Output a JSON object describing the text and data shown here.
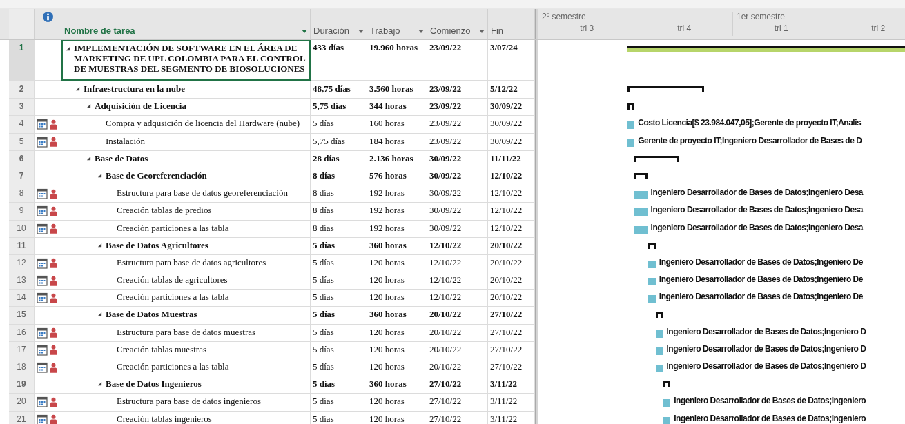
{
  "columns": [
    {
      "label": "Nombre de tarea",
      "kind": "name",
      "selected": true
    },
    {
      "label": "Duración",
      "kind": "filter",
      "selected": false
    },
    {
      "label": "Trabajo",
      "kind": "filter",
      "selected": false
    },
    {
      "label": "Comienzo",
      "kind": "filter",
      "selected": false
    },
    {
      "label": "Fin",
      "kind": "plain",
      "selected": false
    }
  ],
  "timescale": {
    "semesters": [
      "2º semestre",
      "1er semestre"
    ],
    "quarters": [
      "tri 3",
      "tri 4",
      "tri 1",
      "tri 2"
    ]
  },
  "tasks": [
    {
      "id": "1",
      "kind": "project",
      "selected": true,
      "expanded": true,
      "name": "IMPLEMENTACIÓN DE SOFTWARE EN EL ÁREA DE MARKETING DE UPL COLOMBIA PARA EL CONTROL DE MUESTRAS DEL SEGMENTO DE BIOSOLUCIONES",
      "duration": "433 días",
      "work": "19.960 horas",
      "start": "23/09/22",
      "finish": "3/07/24",
      "children": [
        {
          "id": "2",
          "kind": "summary",
          "selected": false,
          "expanded": true,
          "name": "Infraestructura en la nube",
          "duration": "48,75 días",
          "work": "3.560 horas",
          "start": "23/09/22",
          "finish": "5/12/22",
          "children": [
            {
              "id": "3",
              "kind": "summary",
              "selected": false,
              "expanded": true,
              "name": "Adquisición de Licencia",
              "duration": "5,75 días",
              "work": "344 horas",
              "start": "23/09/22",
              "finish": "30/09/22",
              "children": [
                {
                  "id": "4",
                  "kind": "task",
                  "selected": false,
                  "name": "Compra y adqusición de licencia del Hardware (nube)",
                  "duration": "5 días",
                  "work": "160 horas",
                  "start": "23/09/22",
                  "finish": "30/09/22",
                  "resources": "Costo Licencia[$ 23.984.047,05];Gerente de proyecto IT;Analis"
                },
                {
                  "id": "5",
                  "kind": "task",
                  "selected": false,
                  "name": "Instalación",
                  "duration": "5,75 días",
                  "work": "184 horas",
                  "start": "23/09/22",
                  "finish": "30/09/22",
                  "resources": "Gerente de proyecto IT;Ingeniero Desarrollador de Bases de D"
                }
              ]
            },
            {
              "id": "6",
              "kind": "summary",
              "selected": false,
              "expanded": true,
              "name": "Base de Datos",
              "duration": "28 días",
              "work": "2.136 horas",
              "start": "30/09/22",
              "finish": "11/11/22",
              "children": [
                {
                  "id": "7",
                  "kind": "summary",
                  "selected": false,
                  "expanded": true,
                  "name": "Base de Georeferenciación",
                  "duration": "8 días",
                  "work": "576 horas",
                  "start": "30/09/22",
                  "finish": "12/10/22",
                  "children": [
                    {
                      "id": "8",
                      "kind": "task",
                      "selected": false,
                      "name": "Estructura para base de datos georeferenciación",
                      "duration": "8 días",
                      "work": "192 horas",
                      "start": "30/09/22",
                      "finish": "12/10/22",
                      "resources": "Ingeniero Desarrollador de Bases de Datos;Ingeniero Desa"
                    },
                    {
                      "id": "9",
                      "kind": "task",
                      "selected": false,
                      "name": "Creación tablas de predios",
                      "duration": "8 días",
                      "work": "192 horas",
                      "start": "30/09/22",
                      "finish": "12/10/22",
                      "resources": "Ingeniero Desarrollador de Bases de Datos;Ingeniero Desa"
                    },
                    {
                      "id": "10",
                      "kind": "task",
                      "selected": false,
                      "name": "Creación particiones a las tabla",
                      "duration": "8 días",
                      "work": "192 horas",
                      "start": "30/09/22",
                      "finish": "12/10/22",
                      "resources": "Ingeniero Desarrollador de Bases de Datos;Ingeniero Desa"
                    }
                  ]
                },
                {
                  "id": "11",
                  "kind": "summary",
                  "selected": false,
                  "expanded": true,
                  "name": "Base de Datos Agricultores",
                  "duration": "5 días",
                  "work": "360 horas",
                  "start": "12/10/22",
                  "finish": "20/10/22",
                  "children": [
                    {
                      "id": "12",
                      "kind": "task",
                      "selected": false,
                      "name": "Estructura para base de datos agricultores",
                      "duration": "5 días",
                      "work": "120 horas",
                      "start": "12/10/22",
                      "finish": "20/10/22",
                      "resources": "Ingeniero Desarrollador de Bases de Datos;Ingeniero De"
                    },
                    {
                      "id": "13",
                      "kind": "task",
                      "selected": false,
                      "name": "Creación tablas de agricultores",
                      "duration": "5 días",
                      "work": "120 horas",
                      "start": "12/10/22",
                      "finish": "20/10/22",
                      "resources": "Ingeniero Desarrollador de Bases de Datos;Ingeniero De"
                    },
                    {
                      "id": "14",
                      "kind": "task",
                      "selected": false,
                      "name": "Creación particiones a las tabla",
                      "duration": "5 días",
                      "work": "120 horas",
                      "start": "12/10/22",
                      "finish": "20/10/22",
                      "resources": "Ingeniero Desarrollador de Bases de Datos;Ingeniero De"
                    }
                  ]
                },
                {
                  "id": "15",
                  "kind": "summary",
                  "selected": false,
                  "expanded": true,
                  "name": "Base de Datos Muestras",
                  "duration": "5 días",
                  "work": "360 horas",
                  "start": "20/10/22",
                  "finish": "27/10/22",
                  "children": [
                    {
                      "id": "16",
                      "kind": "task",
                      "selected": false,
                      "name": "Estructura para base de datos muestras",
                      "duration": "5 días",
                      "work": "120 horas",
                      "start": "20/10/22",
                      "finish": "27/10/22",
                      "resources": "Ingeniero Desarrollador de Bases de Datos;Ingeniero D"
                    },
                    {
                      "id": "17",
                      "kind": "task",
                      "selected": false,
                      "name": "Creación tablas muestras",
                      "duration": "5 días",
                      "work": "120 horas",
                      "start": "20/10/22",
                      "finish": "27/10/22",
                      "resources": "Ingeniero Desarrollador de Bases de Datos;Ingeniero D"
                    },
                    {
                      "id": "18",
                      "kind": "task",
                      "selected": false,
                      "name": "Creación particiones a las tabla",
                      "duration": "5 días",
                      "work": "120 horas",
                      "start": "20/10/22",
                      "finish": "27/10/22",
                      "resources": "Ingeniero Desarrollador de Bases de Datos;Ingeniero D"
                    }
                  ]
                },
                {
                  "id": "19",
                  "kind": "summary",
                  "selected": false,
                  "expanded": true,
                  "name": "Base de Datos Ingenieros",
                  "duration": "5 días",
                  "work": "360 horas",
                  "start": "27/10/22",
                  "finish": "3/11/22",
                  "children": [
                    {
                      "id": "20",
                      "kind": "task",
                      "selected": false,
                      "name": "Estructura para base de datos ingenieros",
                      "duration": "5 días",
                      "work": "120 horas",
                      "start": "27/10/22",
                      "finish": "3/11/22",
                      "resources": "Ingeniero Desarrollador de Bases de Datos;Ingeniero"
                    },
                    {
                      "id": "21",
                      "kind": "task",
                      "selected": false,
                      "name": "Creación tablas ingenieros",
                      "duration": "5 días",
                      "work": "120 horas",
                      "start": "27/10/22",
                      "finish": "3/11/22",
                      "resources": "Ingeniero Desarrollador de Bases de Datos;Ingeniero"
                    }
                  ]
                }
              ]
            }
          ]
        }
      ]
    }
  ]
}
